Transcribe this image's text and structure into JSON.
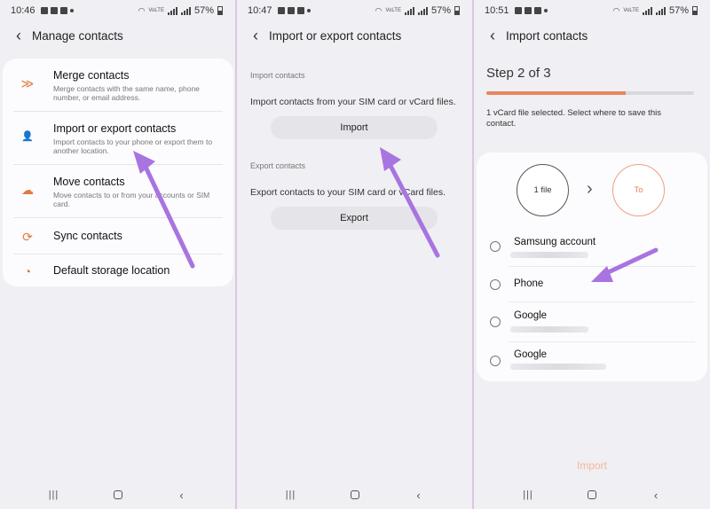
{
  "panel1": {
    "status": {
      "time": "10:46",
      "battery": "57%"
    },
    "title": "Manage contacts",
    "items": [
      {
        "label": "Merge contacts",
        "desc": "Merge contacts with the same name, phone number, or email address.",
        "icon": "merge-icon"
      },
      {
        "label": "Import or export contacts",
        "desc": "Import contacts to your phone or export them to another location.",
        "icon": "import-export-icon"
      },
      {
        "label": "Move contacts",
        "desc": "Move contacts to or from your accounts or SIM card.",
        "icon": "cloud-upload-icon"
      },
      {
        "label": "Sync contacts",
        "desc": "",
        "icon": "sync-icon"
      },
      {
        "label": "Default storage location",
        "desc": "",
        "icon": "storage-pie-icon"
      }
    ]
  },
  "panel2": {
    "status": {
      "time": "10:47",
      "battery": "57%"
    },
    "title": "Import or export contacts",
    "import_section": "Import contacts",
    "import_desc": "Import contacts from your SIM card or vCard files.",
    "import_button": "Import",
    "export_section": "Export contacts",
    "export_desc": "Export contacts to your SIM card or vCard files.",
    "export_button": "Export"
  },
  "panel3": {
    "status": {
      "time": "10:51",
      "battery": "57%"
    },
    "title": "Import contacts",
    "step": "Step 2 of 3",
    "progress": 0.67,
    "info": "1 vCard file selected. Select where to save this contact.",
    "from_label": "1 file",
    "to_label": "To",
    "accounts": [
      {
        "name": "Samsung account"
      },
      {
        "name": "Phone"
      },
      {
        "name": "Google"
      },
      {
        "name": "Google"
      }
    ],
    "import_button": "Import"
  },
  "colors": {
    "accent": "#e07a3f",
    "arrow": "#a874e0",
    "progress": "#e9855e",
    "to_circle": "#f0a07c"
  }
}
